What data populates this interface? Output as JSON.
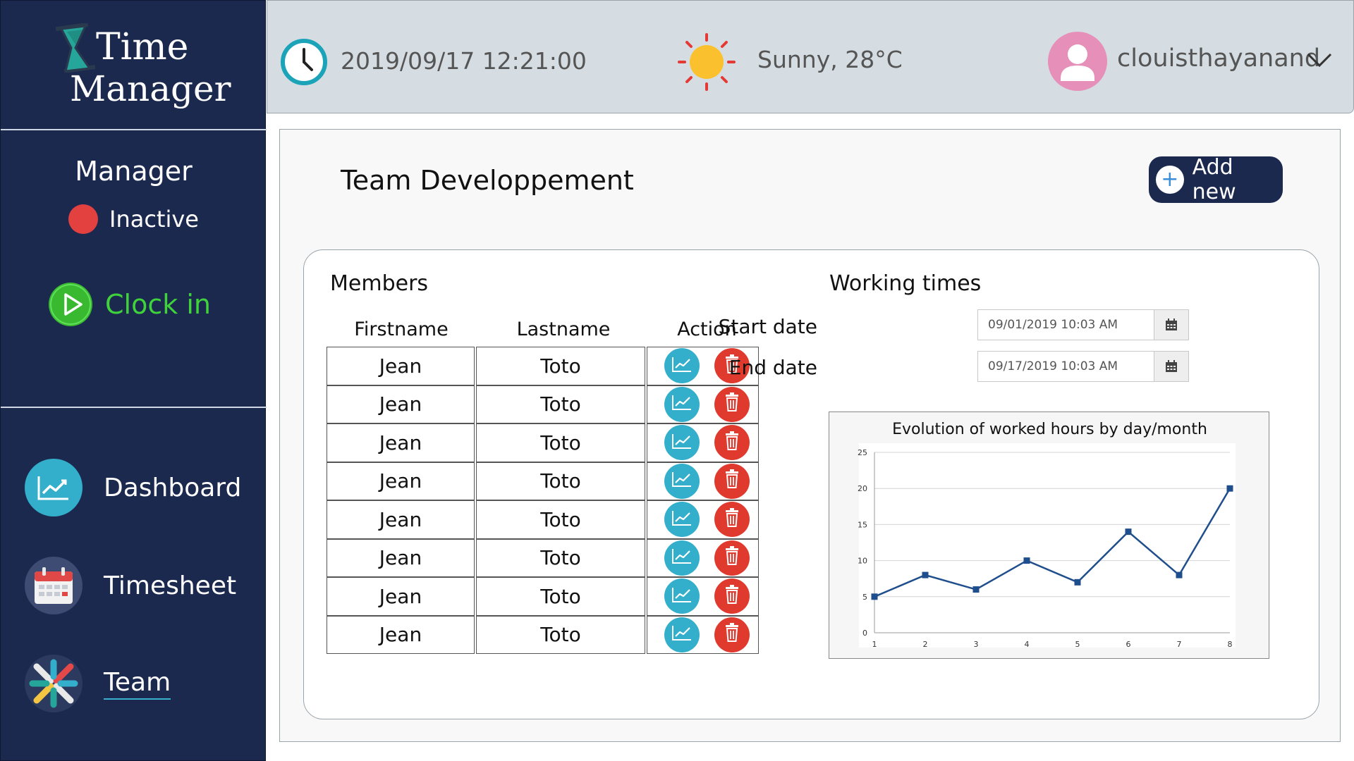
{
  "app": {
    "logo_line1": "Time",
    "logo_line2": "Manager"
  },
  "sidebar": {
    "role": "Manager",
    "status": "Inactive",
    "status_color": "#e34040",
    "clock_in": "Clock in",
    "items": [
      {
        "label": "Dashboard",
        "icon": "dashboard-chart-icon"
      },
      {
        "label": "Timesheet",
        "icon": "calendar-icon"
      },
      {
        "label": "Team",
        "icon": "team-hands-icon",
        "active": true
      }
    ]
  },
  "topbar": {
    "datetime": "2019/09/17 12:21:00",
    "weather": "Sunny, 28°C",
    "username": "clouisthayanand"
  },
  "main": {
    "title": "Team Developpement",
    "add_button": "Add new",
    "members_title": "Members",
    "columns": [
      "Firstname",
      "Lastname",
      "Action"
    ],
    "members": [
      {
        "firstname": "Jean",
        "lastname": "Toto"
      },
      {
        "firstname": "Jean",
        "lastname": "Toto"
      },
      {
        "firstname": "Jean",
        "lastname": "Toto"
      },
      {
        "firstname": "Jean",
        "lastname": "Toto"
      },
      {
        "firstname": "Jean",
        "lastname": "Toto"
      },
      {
        "firstname": "Jean",
        "lastname": "Toto"
      },
      {
        "firstname": "Jean",
        "lastname": "Toto"
      },
      {
        "firstname": "Jean",
        "lastname": "Toto"
      }
    ],
    "working_times_title": "Working times",
    "start_label": "Start date",
    "start_value": "09/01/2019 10:03 AM",
    "end_label": "End date",
    "end_value": "09/17/2019 10:03 AM"
  },
  "chart_data": {
    "type": "line",
    "title": "Evolution of worked hours by day/month",
    "x": [
      1,
      2,
      3,
      4,
      5,
      6,
      7,
      8
    ],
    "series": [
      {
        "values": [
          5,
          8,
          6,
          10,
          7,
          14,
          8,
          20
        ],
        "color": "#1f4e8c"
      }
    ],
    "ylim": [
      0,
      25
    ],
    "yticks": [
      0,
      5,
      10,
      15,
      20,
      25
    ],
    "xlabel": "",
    "ylabel": "",
    "grid": true,
    "legend": "none"
  },
  "colors": {
    "sidebar_bg": "#1b294f",
    "topbar_bg": "#d5dde2",
    "accent_green": "#3fd23a",
    "chart_action": "#33aecb",
    "delete_action": "#e03a2e"
  }
}
